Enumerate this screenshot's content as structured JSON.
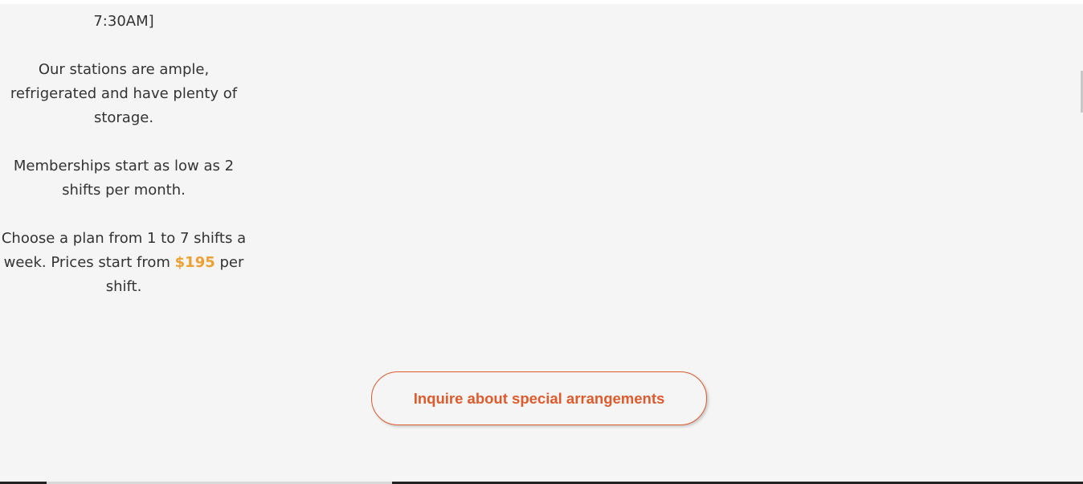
{
  "content": {
    "schedule_tail": "7:30AM]",
    "stations_line1": "Our stations are ample,",
    "stations_line2": "refrigerated and have plenty of",
    "stations_line3": "storage.",
    "memberships_line1": "Memberships start as low as 2",
    "memberships_line2": "shifts per month.",
    "plan_line1": "Choose a plan from 1 to 7 shifts a",
    "plan_line2_prefix": "week. Prices start from ",
    "plan_price": "$195",
    "plan_line2_suffix": " per",
    "plan_line3": "shift."
  },
  "cta": {
    "label": "Inquire about special arrangements"
  },
  "colors": {
    "background": "#f5f5f5",
    "text": "#333333",
    "highlight": "#f0a030",
    "accent": "#e05a2b"
  }
}
